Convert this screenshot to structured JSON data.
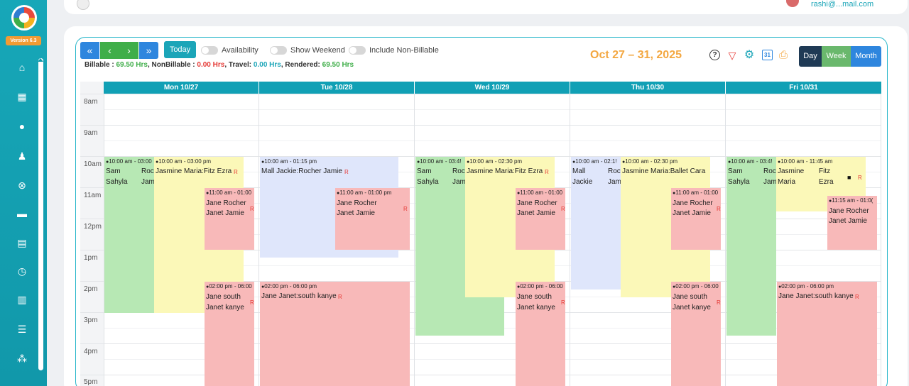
{
  "app": {
    "version_badge": "Version 6.3",
    "user_email": "rashi@...mail.com"
  },
  "sidebar": {
    "icons": [
      "home-icon",
      "calendar-icon",
      "user-icon",
      "users-icon",
      "billing-icon",
      "card-icon",
      "document-icon",
      "clock-icon",
      "chart-icon",
      "menu-icon",
      "network-icon"
    ]
  },
  "toolbar": {
    "nav": {
      "first": "«",
      "prev": "‹",
      "next": "›",
      "last": "»"
    },
    "today_label": "Today",
    "toggles": {
      "availability": "Availability",
      "show_weekend": "Show Weekend",
      "include_non_billable": "Include Non-Billable"
    },
    "summary": {
      "billable_label": "Billable :",
      "billable_value": "69.50 Hrs",
      "nonbillable_label": ", NonBillable :",
      "nonbillable_value": "0.00 Hrs",
      "travel_label": ", Travel:",
      "travel_value": "0.00 Hrs",
      "rendered_label": ", Rendered:",
      "rendered_value": "69.50 Hrs"
    },
    "date_range": "Oct 27 – 31, 2025",
    "views": {
      "day": "Day",
      "week": "Week",
      "month": "Month"
    }
  },
  "calendar": {
    "days": [
      "Mon 10/27",
      "Tue 10/28",
      "Wed 10/29",
      "Thu 10/30",
      "Fri 10/31"
    ],
    "times": [
      "8am",
      "9am",
      "10am",
      "11am",
      "12pm",
      "1pm",
      "2pm",
      "3pm",
      "4pm",
      "5pm"
    ],
    "events": {
      "mon_a": {
        "time": "10:00 am - 03:00",
        "l1": "Sam",
        "l2": "Sahyla"
      },
      "mon_b": {
        "time": "10:00 am - 03:00 pm",
        "text": "Jasmine Maria:Fitz Ezra",
        "r": "R"
      },
      "mon_b_hidden": {
        "l1": "Roch",
        "l2": "Jam"
      },
      "mon_c": {
        "time": "11:00 am - 01:00",
        "l1": "Jane  Rocher",
        "l2": "Janet Jamie",
        "r": "R"
      },
      "mon_d": {
        "time": "02:00 pm - 06:00",
        "l1": "Jane  south",
        "l2": "Janet kanye",
        "r": "R"
      },
      "tue_a": {
        "time": "10:00 am - 01:15 pm",
        "text": "Mall Jackie:Rocher Jamie",
        "r": "R"
      },
      "tue_b": {
        "time": "11:00 am - 01:00 pm",
        "l1": "Jane     Rocher",
        "l2": "Janet    Jamie",
        "r": "R"
      },
      "tue_c": {
        "time": "02:00 pm - 06:00 pm",
        "text": "Jane Janet:south kanye",
        "r": "R"
      },
      "wed_a": {
        "time": "10:00 am - 03:4!",
        "l1": "Sam",
        "l2": "Sahyla",
        "h1": "Roc",
        "h2": "Jam"
      },
      "wed_b": {
        "time": "10:00 am - 02:30 pm",
        "text": "Jasmine Maria:Fitz Ezra",
        "r": "R"
      },
      "wed_c": {
        "time": "11:00 am - 01:00",
        "l1": "Jane  Rocher",
        "l2": "Janet Jamie",
        "r": "R"
      },
      "wed_d": {
        "time": "02:00 pm - 06:00",
        "l1": "Jane  south",
        "l2": "Janet kanye",
        "r": "R"
      },
      "thu_a": {
        "time": "10:00 am - 02:1!",
        "l1": "Mall",
        "l2": "Jackie",
        "h1": "Roc",
        "h2": "Jam"
      },
      "thu_b": {
        "time": "10:00 am - 02:30 pm",
        "text": "Jasmine Maria:Ballet Cara"
      },
      "thu_c": {
        "time": "11:00 am - 01:00",
        "l1": "Jane  Rocher",
        "l2": "Janet Jamie",
        "r": "R"
      },
      "thu_d": {
        "time": "02:00 pm - 06:00",
        "l1": "Jane  south",
        "l2": "Janet kanye",
        "r": "R"
      },
      "fri_a": {
        "time": "10:00 am - 03:4!",
        "l1": "Sam",
        "l2": "Sahyla",
        "h1": "Roc",
        "h2": "Jam"
      },
      "fri_b": {
        "time": "10:00 am - 11:45 am",
        "l1": "Jasmine",
        "l2": "Maria",
        "m1": "Fitz",
        "m2": "Ezra",
        "r": "R"
      },
      "fri_c": {
        "time": "11:15 am - 01:0(",
        "l1": "Jane  Rocher",
        "l2": "Janet Jamie"
      },
      "fri_d": {
        "time": "02:00 pm - 06:00 pm",
        "text": "Jane Janet:south kanye",
        "r": "R"
      }
    }
  }
}
